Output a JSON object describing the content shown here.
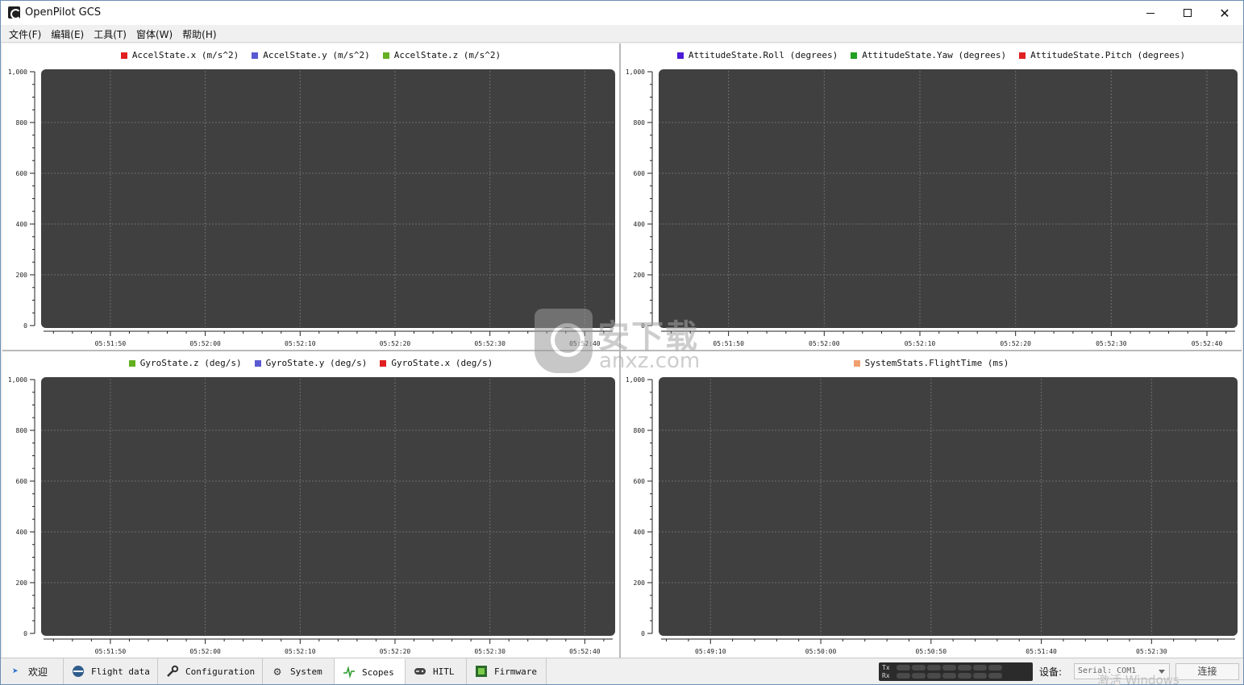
{
  "window": {
    "title": "OpenPilot GCS",
    "min_icon": "minimize-icon",
    "max_icon": "maximize-icon",
    "close_icon": "close-icon",
    "close_glyph": "✕"
  },
  "menu": [
    "文件(F)",
    "编辑(E)",
    "工具(T)",
    "窗体(W)",
    "帮助(H)"
  ],
  "colors": {
    "plot_bg": "#404040",
    "grid": "#6e6e6e",
    "accel_x": "#e02020",
    "accel_y": "#5a5ad2",
    "accel_z": "#64b020",
    "roll": "#4a1ad8",
    "yaw": "#21a021",
    "pitch": "#e02020",
    "gyro_z": "#64b020",
    "gyro_y": "#5a5ad2",
    "gyro_x": "#e02020",
    "flighttime": "#f0a070"
  },
  "chart_data": [
    {
      "type": "line",
      "legend": [
        "AccelState.x (m/s^2)",
        "AccelState.y (m/s^2)",
        "AccelState.z (m/s^2)"
      ],
      "yticks": [
        "0",
        "200",
        "400",
        "600",
        "800",
        "1,000"
      ],
      "xticks": [
        "05:51:50",
        "05:52:00",
        "05:52:10",
        "05:52:20",
        "05:52:30",
        "05:52:40"
      ],
      "ylim": [
        0,
        1000
      ],
      "grid": true,
      "series": [
        {
          "name": "AccelState.x (m/s^2)",
          "values": []
        },
        {
          "name": "AccelState.y (m/s^2)",
          "values": []
        },
        {
          "name": "AccelState.z (m/s^2)",
          "values": []
        }
      ]
    },
    {
      "type": "line",
      "legend": [
        "AttitudeState.Roll (degrees)",
        "AttitudeState.Yaw (degrees)",
        "AttitudeState.Pitch (degrees)"
      ],
      "yticks": [
        "0",
        "200",
        "400",
        "600",
        "800",
        "1,000"
      ],
      "xticks": [
        "05:51:50",
        "05:52:00",
        "05:52:10",
        "05:52:20",
        "05:52:30",
        "05:52:40"
      ],
      "ylim": [
        0,
        1000
      ],
      "grid": true,
      "series": [
        {
          "name": "AttitudeState.Roll (degrees)",
          "values": []
        },
        {
          "name": "AttitudeState.Yaw (degrees)",
          "values": []
        },
        {
          "name": "AttitudeState.Pitch (degrees)",
          "values": []
        }
      ]
    },
    {
      "type": "line",
      "legend": [
        "GyroState.z (deg/s)",
        "GyroState.y (deg/s)",
        "GyroState.x (deg/s)"
      ],
      "yticks": [
        "0",
        "200",
        "400",
        "600",
        "800",
        "1,000"
      ],
      "xticks": [
        "05:51:50",
        "05:52:00",
        "05:52:10",
        "05:52:20",
        "05:52:30",
        "05:52:40"
      ],
      "ylim": [
        0,
        1000
      ],
      "grid": true,
      "series": [
        {
          "name": "GyroState.z (deg/s)",
          "values": []
        },
        {
          "name": "GyroState.y (deg/s)",
          "values": []
        },
        {
          "name": "GyroState.x (deg/s)",
          "values": []
        }
      ]
    },
    {
      "type": "line",
      "legend": [
        "SystemStats.FlightTime (ms)"
      ],
      "yticks": [
        "0",
        "200",
        "400",
        "600",
        "800",
        "1,000"
      ],
      "xticks": [
        "05:49:10",
        "05:50:00",
        "05:50:50",
        "05:51:40",
        "05:52:30"
      ],
      "ylim": [
        0,
        1000
      ],
      "grid": true,
      "series": [
        {
          "name": "SystemStats.FlightTime (ms)",
          "values": []
        }
      ]
    }
  ],
  "tabs": [
    {
      "label": "欢迎",
      "icon": "welcome-icon"
    },
    {
      "label": "Flight data",
      "icon": "flight-data-icon"
    },
    {
      "label": "Configuration",
      "icon": "wrench-icon"
    },
    {
      "label": "System",
      "icon": "gear-icon"
    },
    {
      "label": "Scopes",
      "icon": "scope-icon"
    },
    {
      "label": "HITL",
      "icon": "gamepad-icon"
    },
    {
      "label": "Firmware",
      "icon": "chip-icon"
    }
  ],
  "status": {
    "tx_label": "Tx",
    "rx_label": "Rx",
    "device_label": "设备:",
    "device_value": "Serial: COM1",
    "connect_label": "连接"
  },
  "watermark": {
    "site_cn": "安下载",
    "site_url": "anxz.com",
    "activate": "激活 Windows"
  }
}
